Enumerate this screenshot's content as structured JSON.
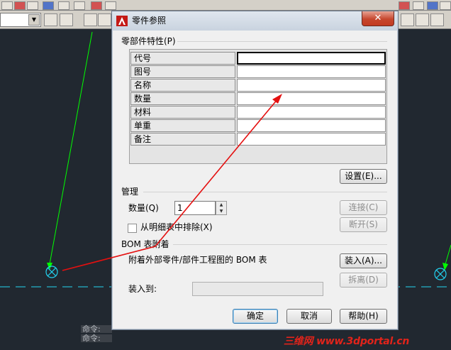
{
  "dialog": {
    "title": "零件参照",
    "close_glyph": "✕",
    "properties_group_label": "零部件特性(P)",
    "properties": [
      {
        "name": "代号",
        "value": ""
      },
      {
        "name": "图号",
        "value": ""
      },
      {
        "name": "名称",
        "value": ""
      },
      {
        "name": "数量",
        "value": ""
      },
      {
        "name": "材料",
        "value": ""
      },
      {
        "name": "单重",
        "value": ""
      },
      {
        "name": "备注",
        "value": ""
      }
    ],
    "settings_button": "设置(E)...",
    "manage_group_label": "管理",
    "quantity_label": "数量(Q)",
    "quantity_value": "1",
    "connect_button": "连接(C)",
    "disconnect_button": "断开(S)",
    "exclude_from_bom_label": "从明细表中排除(X)",
    "exclude_checked": false,
    "bom_attach_group_label": "BOM 表附着",
    "bom_attach_description": "附着外部零件/部件工程图的 BOM 表",
    "load_button": "装入(A)...",
    "detach_button": "拆离(D)",
    "attach_to_label": "装入到:",
    "attach_to_value": "",
    "ok_button": "确定",
    "cancel_button": "取消",
    "help_button": "帮助(H)"
  },
  "command_line": {
    "lines": [
      "命令:",
      "命令:"
    ]
  },
  "watermark": "三维网 www.3dportal.cn",
  "colors": {
    "canvas_bg": "#212830",
    "guide_line": "#00ff00",
    "center_line": "#22d3f0",
    "annotation_arrow": "#e41010",
    "close_button": "#c6472e"
  }
}
